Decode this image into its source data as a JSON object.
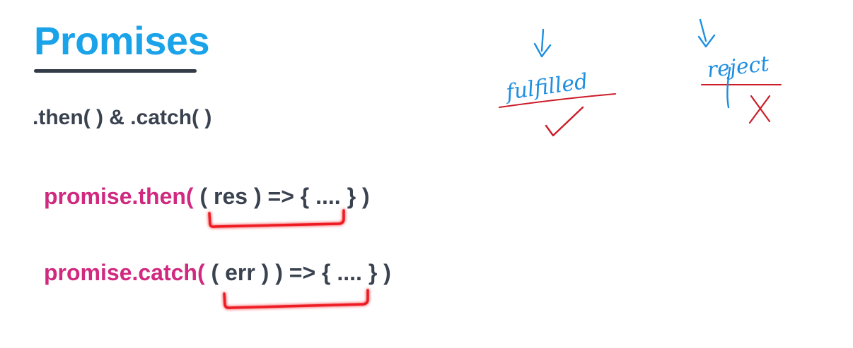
{
  "slide": {
    "title": "Promises",
    "subtitle": ".then( ) & .catch( )",
    "code": {
      "then": {
        "method": "promise.then(",
        "args": " ( res ) => { .... } )"
      },
      "catch": {
        "method": "promise.catch(",
        "args": " ( err ) ) => { .... } )"
      }
    },
    "annotations": {
      "fulfilled": "fulfilled",
      "reject": "reject",
      "check_icon": "checkmark-icon",
      "x_icon": "x-mark-icon",
      "arrow_icon": "arrow-down-icon"
    }
  },
  "colors": {
    "title": "#1aa3e8",
    "title_underline": "#333b47",
    "text_dark": "#3a4250",
    "code_method": "#d0297f",
    "highlight_red": "#ee1c24",
    "ink_blue": "#1e8fe0",
    "ink_red": "#cc1c28"
  }
}
